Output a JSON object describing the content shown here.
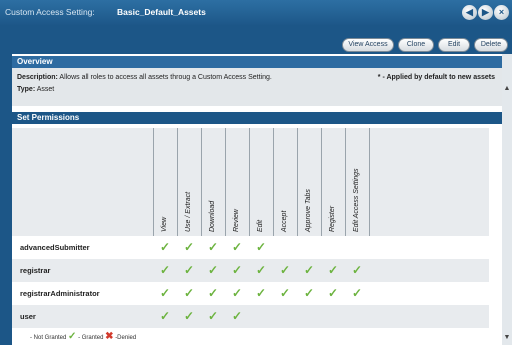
{
  "window": {
    "title_prefix": "Custom Access Setting:",
    "title_name": "Basic_Default_Assets",
    "buttons": [
      "×",
      "▶",
      "◀"
    ]
  },
  "toolbar": {
    "view_access": "View Access",
    "clone": "Clone",
    "edit": "Edit",
    "delete": "Delete"
  },
  "overview": {
    "heading": "Overview",
    "description_label": "Description:",
    "description_value": "Allows all roles to access all assets throug a Custom Access Setting.",
    "applied_note": "* - Applied by default to new assets",
    "type_label": "Type:",
    "type_value": "Asset"
  },
  "permissions": {
    "heading": "Set Permissions",
    "columns": [
      "View",
      "Use / Extract",
      "Download",
      "Review",
      "Edit",
      "Accept",
      "Approve Tabs",
      "Register",
      "Edit Access Settings"
    ],
    "rows": [
      {
        "name": "advancedSubmitter",
        "granted": [
          true,
          true,
          true,
          true,
          true,
          false,
          false,
          false,
          false
        ]
      },
      {
        "name": "registrar",
        "granted": [
          true,
          true,
          true,
          true,
          true,
          true,
          true,
          true,
          true
        ]
      },
      {
        "name": "registrarAdministrator",
        "granted": [
          true,
          true,
          true,
          true,
          true,
          true,
          true,
          true,
          true
        ]
      },
      {
        "name": "user",
        "granted": [
          true,
          true,
          true,
          true,
          false,
          false,
          false,
          false,
          false
        ]
      }
    ],
    "check_glyph": "✓"
  },
  "legend": {
    "not_granted": "- Not Granted",
    "granted": "- Granted",
    "denied": "-Denied",
    "check_glyph": "✓",
    "cross_glyph": "✖"
  },
  "colors": {
    "titlebar": "#1c5687",
    "section_header": "#2d6ba1",
    "granted": "#6cb33f",
    "denied": "#d23a2c"
  }
}
